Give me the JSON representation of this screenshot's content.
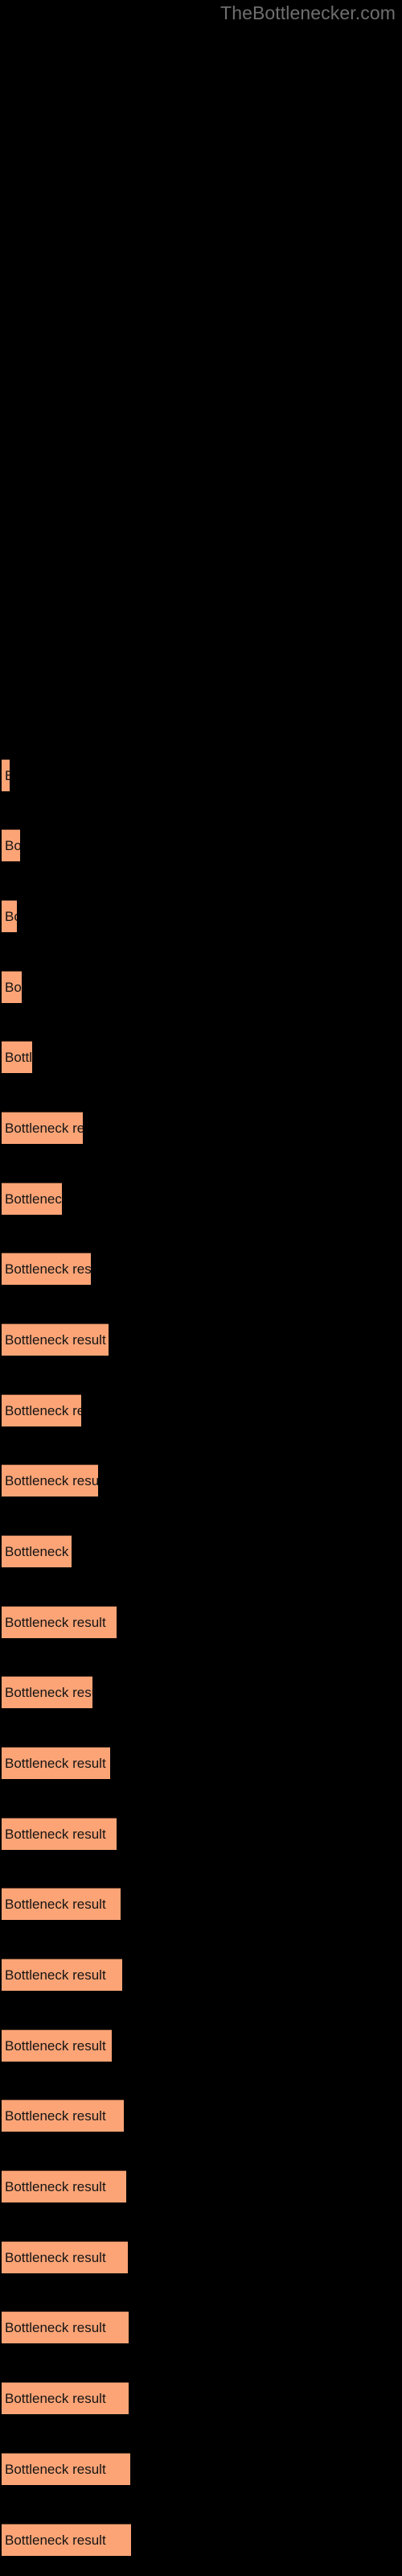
{
  "header": {
    "site_title": "TheBottlenecker.com",
    "title_color": "#6e6e6e"
  },
  "colors": {
    "background": "#000000",
    "bar_fill": "#fca476",
    "bar_edge": "#5a3a28",
    "bar_text": "#141414"
  },
  "chart_data": {
    "type": "bar",
    "orientation": "horizontal",
    "title": "",
    "subtitle": "",
    "xlabel": "",
    "ylabel": "",
    "grid": false,
    "legend": null,
    "axis_visible": false,
    "tick_labels_visible": false,
    "bar_label_text": "Bottleneck result",
    "xlim": [
      0,
      500
    ],
    "categories": [
      "Bottleneck result 1",
      "Bottleneck result 2",
      "Bottleneck result 3",
      "Bottleneck result 4",
      "Bottleneck result 5",
      "Bottleneck result 6",
      "Bottleneck result 7",
      "Bottleneck result 8",
      "Bottleneck result 9",
      "Bottleneck result 10",
      "Bottleneck result 11",
      "Bottleneck result 12",
      "Bottleneck result 13",
      "Bottleneck result 14",
      "Bottleneck result 15",
      "Bottleneck result 16",
      "Bottleneck result 17",
      "Bottleneck result 18",
      "Bottleneck result 19",
      "Bottleneck result 20",
      "Bottleneck result 21",
      "Bottleneck result 22",
      "Bottleneck result 23",
      "Bottleneck result 24",
      "Bottleneck result 25",
      "Bottleneck result 26"
    ],
    "values": [
      10,
      23,
      19,
      25,
      38,
      57,
      45,
      66,
      80,
      59,
      72,
      52,
      86,
      68,
      81,
      86,
      89,
      90,
      82,
      91,
      93,
      94,
      95,
      95,
      96,
      97
    ],
    "bars": [
      {
        "label": "Bottleneck result",
        "value": 10,
        "y": 943,
        "width": 10
      },
      {
        "label": "Bottleneck result",
        "value": 23,
        "y": 1030,
        "width": 23
      },
      {
        "label": "Bottleneck result",
        "value": 19,
        "y": 1118,
        "width": 19
      },
      {
        "label": "Bottleneck result",
        "value": 25,
        "y": 1206,
        "width": 25
      },
      {
        "label": "Bottleneck result",
        "value": 38,
        "y": 1293,
        "width": 38
      },
      {
        "label": "Bottleneck result",
        "value": 57,
        "y": 1381,
        "width": 101
      },
      {
        "label": "Bottleneck result",
        "value": 45,
        "y": 1469,
        "width": 75
      },
      {
        "label": "Bottleneck result",
        "value": 66,
        "y": 1556,
        "width": 111
      },
      {
        "label": "Bottleneck result",
        "value": 80,
        "y": 1644,
        "width": 133
      },
      {
        "label": "Bottleneck result",
        "value": 59,
        "y": 1732,
        "width": 99
      },
      {
        "label": "Bottleneck result",
        "value": 72,
        "y": 1819,
        "width": 120
      },
      {
        "label": "Bottleneck result",
        "value": 52,
        "y": 1907,
        "width": 87
      },
      {
        "label": "Bottleneck result",
        "value": 86,
        "y": 1995,
        "width": 143
      },
      {
        "label": "Bottleneck result",
        "value": 68,
        "y": 2082,
        "width": 113
      },
      {
        "label": "Bottleneck result",
        "value": 81,
        "y": 2170,
        "width": 135
      },
      {
        "label": "Bottleneck result",
        "value": 86,
        "y": 2258,
        "width": 143
      },
      {
        "label": "Bottleneck result",
        "value": 89,
        "y": 2345,
        "width": 148
      },
      {
        "label": "Bottleneck result",
        "value": 90,
        "y": 2433,
        "width": 150
      },
      {
        "label": "Bottleneck result",
        "value": 82,
        "y": 2521,
        "width": 137
      },
      {
        "label": "Bottleneck result",
        "value": 91,
        "y": 2608,
        "width": 152
      },
      {
        "label": "Bottleneck result",
        "value": 93,
        "y": 2696,
        "width": 155
      },
      {
        "label": "Bottleneck result",
        "value": 94,
        "y": 2784,
        "width": 157
      },
      {
        "label": "Bottleneck result",
        "value": 95,
        "y": 2871,
        "width": 158
      },
      {
        "label": "Bottleneck result",
        "value": 95,
        "y": 2959,
        "width": 158
      },
      {
        "label": "Bottleneck result",
        "value": 96,
        "y": 3047,
        "width": 160
      },
      {
        "label": "Bottleneck result",
        "value": 97,
        "y": 3135,
        "width": 161
      }
    ]
  }
}
